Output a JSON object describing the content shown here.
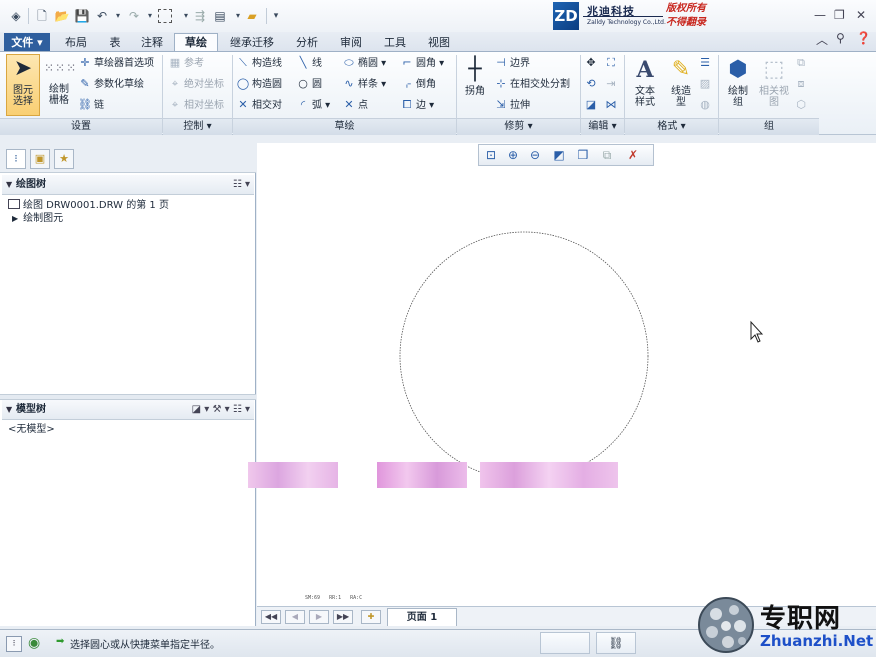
{
  "brand": {
    "logo_letter": "ZD",
    "name_cn": "兆迪科技",
    "name_en": "Zalldy Technology Co.,Ltd.",
    "copyright_line1": "版权所有",
    "copyright_line2": "不得翻录"
  },
  "menu": {
    "file_label": "文件",
    "tabs": [
      "布局",
      "表",
      "注释",
      "草绘",
      "继承迁移",
      "分析",
      "审阅",
      "工具",
      "视图"
    ],
    "active_tab": "草绘"
  },
  "ribbon": {
    "groups": {
      "setup": "设置",
      "control": "控制",
      "sketch": "草绘",
      "trim": "修剪",
      "edit": "编辑",
      "format": "格式",
      "group": "组"
    },
    "setup": {
      "select_label": "图元\n选择",
      "grid_label": "绘制\n栅格",
      "sketcher_prefs": "草绘器首选项",
      "param_sketch": "参数化草绘",
      "chain": "链"
    },
    "control": {
      "reference": "参考",
      "absolute_coords": "绝对坐标",
      "relative_coords": "相对坐标"
    },
    "sketch": {
      "construction_line": "构造线",
      "construction_circle": "构造圆",
      "intersect": "相交对",
      "line": "线",
      "circle": "圆",
      "arc": "弧",
      "ellipse": "椭圆",
      "spline": "样条",
      "point": "点",
      "fillet": "圆角",
      "chamfer": "倒角",
      "edge": "边"
    },
    "trim": {
      "corner": "拐角",
      "boundary": "边界",
      "split_at_intersect": "在相交处分割",
      "stretch": "拉伸"
    },
    "format": {
      "text_style": "文本\n样式",
      "line_style": "线造\n型"
    },
    "group": {
      "draw_group": "绘制\n组",
      "related_view": "相关视\n图"
    }
  },
  "left_panel": {
    "drawing_tree_title": "绘图树",
    "drawing_tree_items": [
      "绘图 DRW0001.DRW 的第 1 页",
      "绘制图元"
    ],
    "model_tree_title": "模型树",
    "model_tree_empty": "<无模型>"
  },
  "canvas": {
    "scale_text": "SM:69   RR:1   RA:C"
  },
  "page_bar": {
    "page_label": "页面 1"
  },
  "status": {
    "message": "选择圆心或从快捷菜单指定半径。"
  },
  "watermark": {
    "name": "专职网",
    "url": "Zhuanzhi.Net"
  },
  "colors": {
    "accent": "#2a5ea8",
    "brand_red": "#c8261e",
    "selection": "#f9cf73"
  }
}
